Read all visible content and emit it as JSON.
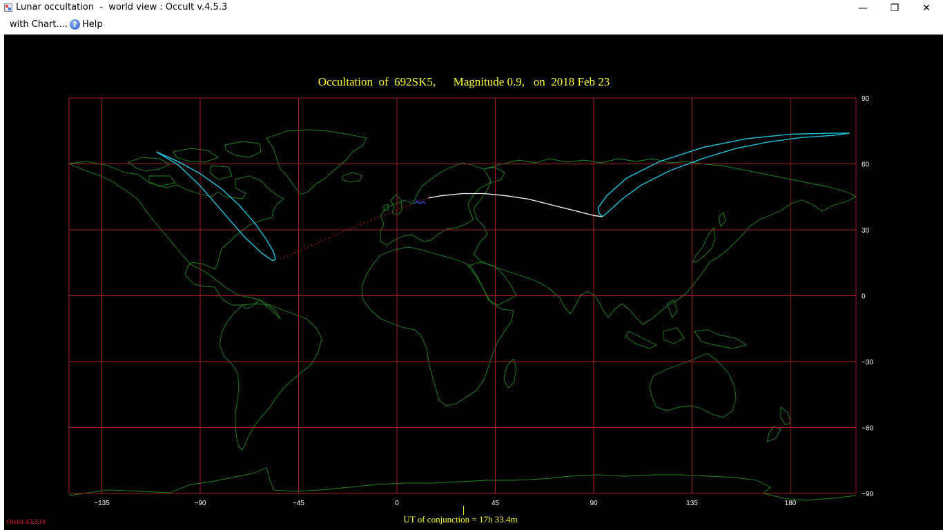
{
  "window": {
    "title": "Lunar occultation  -  world view : Occult v.4.5.3",
    "minimize_glyph": "—",
    "maximize_glyph": "❐",
    "close_glyph": "✕",
    "app_icon": "window-app-icon"
  },
  "menu": {
    "items": [
      {
        "label": "with Chart...."
      },
      {
        "label": "Help",
        "icon": "question-circle-icon",
        "icon_glyph": "?"
      }
    ]
  },
  "chart": {
    "title": "Occultation  of  692SK5,      Magnitude 0.9,   on  2018 Feb 23",
    "footer": "UT of conjunction = 17h 33.4m",
    "version": "Occult 4.5.3.14",
    "colors": {
      "background": "#000000",
      "grid": "#a52020",
      "coast": "#1f8a1f",
      "title": "#ffff33",
      "axis_text": "#ffffff",
      "limit_curve": "#21c4dd",
      "central_path": "#ffffff",
      "invisible_path": "#d42020",
      "version_text": "#ff2020"
    }
  },
  "chart_data": {
    "type": "line",
    "title": "Occultation  of  692SK5,      Magnitude 0.9,   on  2018 Feb 23",
    "xlabel": "",
    "ylabel": "",
    "xlim": [
      -150,
      210
    ],
    "ylim": [
      -90,
      90
    ],
    "x_ticks": [
      -135,
      -90,
      -45,
      0,
      45,
      90,
      135,
      180
    ],
    "y_ticks": [
      90,
      60,
      30,
      0,
      -30,
      -60,
      -90
    ],
    "grid": true,
    "series": [
      {
        "style": "cyan",
        "x": [
          -110,
          -100,
          -90,
          -80,
          -72,
          -65,
          -60,
          -56.5,
          -55.5,
          -57,
          -62,
          -70,
          -80,
          -90,
          -100,
          -110
        ],
        "y": [
          65.5,
          61,
          55.5,
          48.5,
          41,
          33,
          26,
          20,
          16.5,
          16,
          19.5,
          27,
          38.5,
          50,
          59.5,
          65.5
        ]
      },
      {
        "style": "cyan",
        "x": [
          94,
          97,
          103,
          112,
          125,
          140,
          155,
          170,
          185,
          200,
          207,
          200,
          180,
          160,
          140,
          120,
          105,
          96,
          92,
          92.5,
          94
        ],
        "y": [
          36,
          38.5,
          44,
          50.5,
          57,
          62.5,
          67,
          70,
          72,
          73,
          74,
          74,
          73.5,
          71.5,
          67.5,
          61,
          53.5,
          45.5,
          40,
          37.5,
          36
        ]
      },
      {
        "style": "white",
        "x": [
          14.5,
          20,
          30,
          40,
          50,
          60,
          70,
          80,
          90,
          94
        ],
        "y": [
          44.5,
          45.5,
          46.5,
          46.5,
          45.5,
          44,
          41.5,
          39,
          36.5,
          36
        ]
      },
      {
        "style": "red_dotted",
        "x": [
          -53.5,
          -40,
          -25,
          -10,
          5,
          14.5
        ],
        "y": [
          16.5,
          22.5,
          29,
          35,
          41,
          44.5
        ]
      }
    ],
    "markers": [
      {
        "x": 10,
        "y": 42.5,
        "style": "blue"
      }
    ],
    "conjunction_marker_longitude": 30.5
  }
}
